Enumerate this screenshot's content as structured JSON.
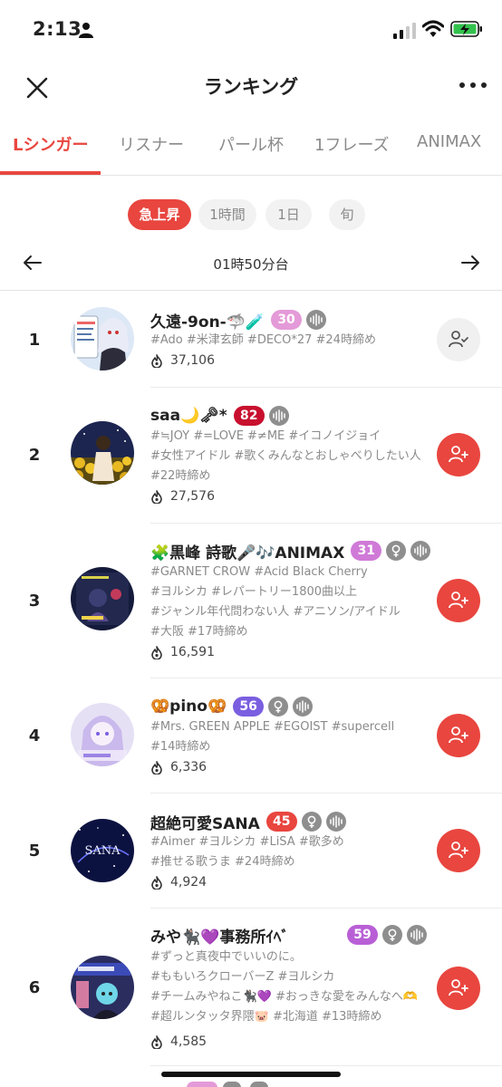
{
  "status_bar": {
    "time": "2:13"
  },
  "header": {
    "title": "ランキング"
  },
  "tabs": [
    {
      "label": "Lシンガー",
      "active": true
    },
    {
      "label": "リスナー",
      "active": false
    },
    {
      "label": "パール杯",
      "active": false
    },
    {
      "label": "1フレーズ",
      "active": false
    },
    {
      "label": "ANIMAX",
      "active": false
    }
  ],
  "filters": [
    {
      "label": "急上昇",
      "active": true
    },
    {
      "label": "1時間",
      "active": false
    },
    {
      "label": "1日",
      "active": false
    },
    {
      "label": "旬",
      "active": false
    }
  ],
  "period": {
    "label": "01時50分台"
  },
  "rankings": [
    {
      "rank": "1",
      "name": "久遠-9on-🦈🧪",
      "level": "30",
      "level_color": "#e49ad8",
      "badges": [
        "voice-icon"
      ],
      "tags": [
        "#Ado #米津玄師 #DECO*27 #24時締め"
      ],
      "score": "37,106",
      "following": true
    },
    {
      "rank": "2",
      "name": "saa🌙🗝*",
      "level": "82",
      "level_color": "#c8102e",
      "badges": [
        "voice-icon"
      ],
      "tags": [
        "#≒JOY #=LOVE #≠ME #イコノイジョイ",
        "#女性アイドル #歌くみんなとおしゃべりしたい人",
        "#22時締め"
      ],
      "score": "27,576",
      "following": false
    },
    {
      "rank": "3",
      "name": "🧩黒峰 詩歌🎤🎶ANIMAX",
      "level": "31",
      "level_color": "#d07ad8",
      "badges": [
        "female-icon",
        "voice-icon"
      ],
      "tags": [
        "#GARNET CROW #Acid Black Cherry",
        "#ヨルシカ #レパートリー1800曲以上",
        "#ジャンル年代問わない人 #アニソン/アイドル",
        "#大阪 #17時締め"
      ],
      "score": "16,591",
      "following": false
    },
    {
      "rank": "4",
      "name": "🥨pino🥨",
      "level": "56",
      "level_color": "#7a5ee0",
      "badges": [
        "female-icon",
        "voice-icon"
      ],
      "tags": [
        "#Mrs. GREEN APPLE #EGOIST #supercell",
        "#14時締め"
      ],
      "score": "6,336",
      "following": false
    },
    {
      "rank": "5",
      "name": "超絶可愛SANA",
      "level": "45",
      "level_color": "#e8463f",
      "badges": [
        "female-icon",
        "voice-icon"
      ],
      "tags": [
        "#Aimer #ヨルシカ #LiSA #歌多め",
        "#推せる歌うま #24時締め"
      ],
      "score": "4,924",
      "following": false
    },
    {
      "rank": "6",
      "name": "みや🐈‍⬛💜事務所ｲﾍﾞ",
      "level": "59",
      "level_color": "#b85fd6",
      "badges": [
        "female-icon",
        "voice-icon"
      ],
      "tags": [
        "#ずっと真夜中でいいのに。",
        "#ももいろクローバーZ #ヨルシカ",
        "#チームみやねこ🐈‍⬛💜 #おっきな愛をみんなへ🫶",
        "#超ルンタッタ界隈🐷 #北海道 #13時締め"
      ],
      "score": "4,585",
      "following": false
    }
  ]
}
